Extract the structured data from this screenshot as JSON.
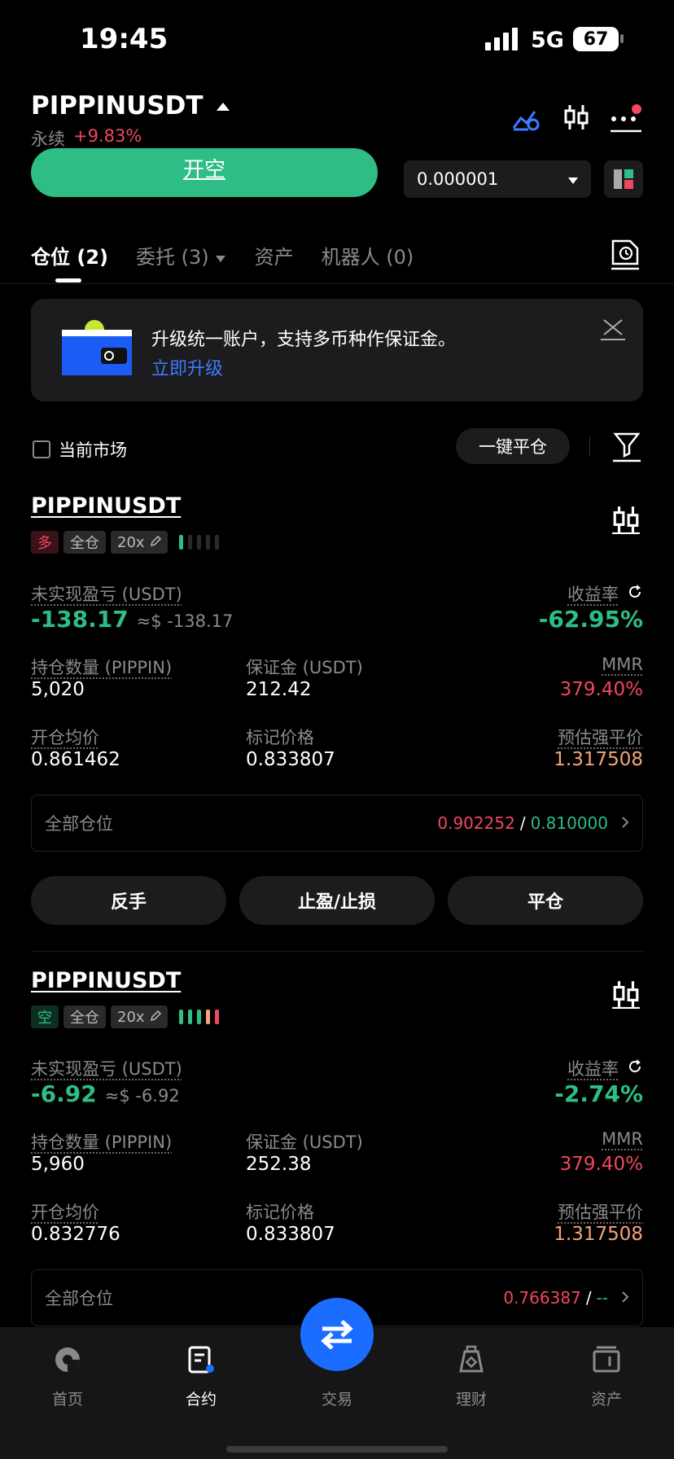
{
  "status_bar": {
    "time": "19:45",
    "network": "5G",
    "battery": "67"
  },
  "header": {
    "symbol": "PIPPINUSDT",
    "contract_type": "永续",
    "change": "+9.83%"
  },
  "order": {
    "open_short_label": "开空",
    "price_step": "0.000001"
  },
  "tabs": [
    {
      "label": "仓位 (2)"
    },
    {
      "label": "委托 (3)"
    },
    {
      "label": "资产"
    },
    {
      "label": "机器人 (0)"
    }
  ],
  "banner": {
    "text": "升级统一账户，支持多币种作保证金。",
    "link": "立即升级"
  },
  "filters": {
    "current_market": "当前市场",
    "close_all": "一键平仓"
  },
  "labels": {
    "unrealized_pnl": "未实现盈亏 (USDT)",
    "roe": "收益率",
    "position_size": "持仓数量 (PIPPIN)",
    "margin": "保证金 (USDT)",
    "mmr": "MMR",
    "entry_price": "开仓均价",
    "mark_price": "标记价格",
    "liq_price": "预估强平价",
    "all_positions": "全部仓位",
    "slash": "/"
  },
  "actions": {
    "reverse": "反手",
    "tpsl": "止盈/止损",
    "close": "平仓"
  },
  "positions": [
    {
      "symbol": "PIPPINUSDT",
      "side": "多",
      "mode": "全仓",
      "leverage": "20x",
      "pnl": "-138.17",
      "pnl_usd": "≈$ -138.17",
      "roe": "-62.95%",
      "size": "5,020",
      "margin": "212.42",
      "mmr": "379.40%",
      "entry": "0.861462",
      "mark": "0.833807",
      "liq": "1.317508",
      "tp": "0.902252",
      "sl": "0.810000"
    },
    {
      "symbol": "PIPPINUSDT",
      "side": "空",
      "mode": "全仓",
      "leverage": "20x",
      "pnl": "-6.92",
      "pnl_usd": "≈$ -6.92",
      "roe": "-2.74%",
      "size": "5,960",
      "margin": "252.38",
      "mmr": "379.40%",
      "entry": "0.832776",
      "mark": "0.833807",
      "liq": "1.317508",
      "tp": "0.766387",
      "sl": "--"
    }
  ],
  "bottom_nav": [
    {
      "label": "首页",
      "icon": "home-icon"
    },
    {
      "label": "合约",
      "icon": "contract-icon"
    },
    {
      "label": "交易",
      "icon": "trade-swap-icon"
    },
    {
      "label": "理财",
      "icon": "finance-icon"
    },
    {
      "label": "资产",
      "icon": "wallet-icon"
    }
  ],
  "colors": {
    "green": "#2ebd85",
    "red": "#f0475e",
    "orange": "#f4a477",
    "blue": "#1a6dff"
  }
}
